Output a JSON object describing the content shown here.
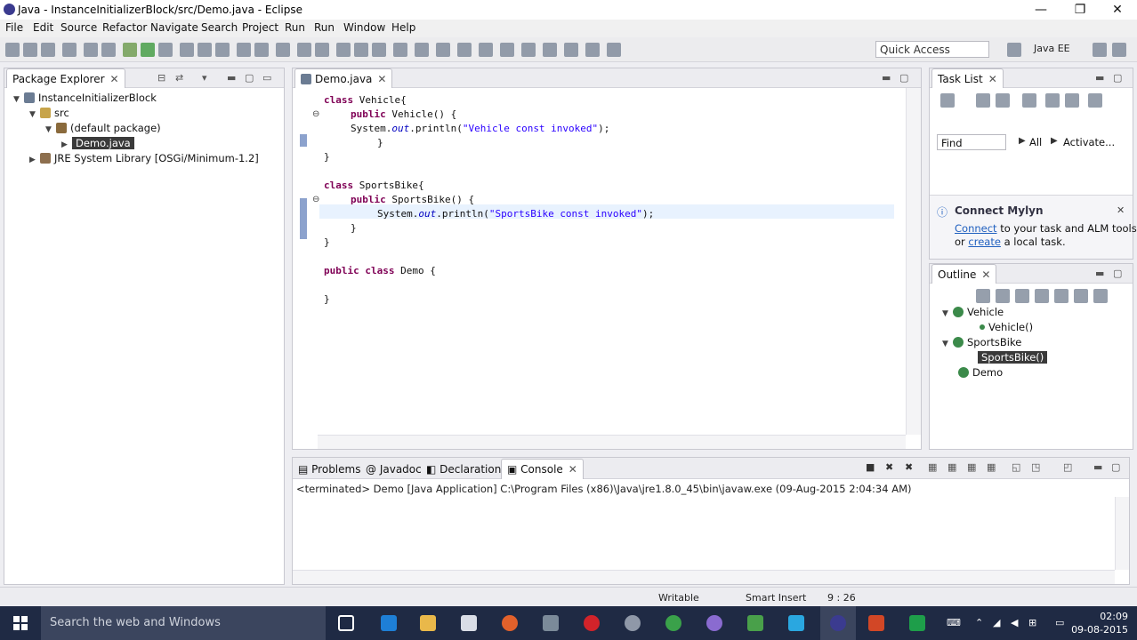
{
  "window": {
    "title": "Java - InstanceInitializerBlock/src/Demo.java - Eclipse"
  },
  "menu": [
    "File",
    "Edit",
    "Source",
    "Refactor",
    "Navigate",
    "Search",
    "Project",
    "Run",
    "Run",
    "Window",
    "Help"
  ],
  "toolbar": {
    "quick_access": "Quick Access",
    "perspective": "Java EE"
  },
  "package_explorer": {
    "tab": "Package Explorer",
    "tree": [
      {
        "label": "InstanceInitializerBlock",
        "level": 0,
        "expanded": true
      },
      {
        "label": "src",
        "level": 1,
        "expanded": true
      },
      {
        "label": "(default package)",
        "level": 2,
        "expanded": true
      },
      {
        "label": "Demo.java",
        "level": 3,
        "expanded": false,
        "selected": true
      },
      {
        "label": "JRE System Library [OSGi/Minimum-1.2]",
        "level": 1,
        "expanded": false
      }
    ]
  },
  "editor": {
    "tab": "Demo.java",
    "lines": [
      {
        "indent": 0,
        "tokens": [
          [
            "kw",
            "class"
          ],
          [
            "t",
            " Vehicle{"
          ]
        ]
      },
      {
        "indent": 1,
        "fold": "⊖",
        "tokens": [
          [
            "kw",
            "public"
          ],
          [
            "t",
            " Vehicle() {"
          ]
        ]
      },
      {
        "indent": 1,
        "tokens": [
          [
            "t",
            "System."
          ],
          [
            "fld",
            "out"
          ],
          [
            "t",
            ".println("
          ],
          [
            "str",
            "\"Vehicle const invoked\""
          ],
          [
            "t",
            ");"
          ]
        ]
      },
      {
        "indent": 2,
        "tokens": [
          [
            "t",
            "}"
          ]
        ]
      },
      {
        "indent": 0,
        "tokens": [
          [
            "t",
            "}"
          ]
        ]
      },
      {
        "indent": 0,
        "tokens": []
      },
      {
        "indent": 0,
        "tokens": [
          [
            "kw",
            "class"
          ],
          [
            "t",
            " SportsBike{"
          ]
        ]
      },
      {
        "indent": 1,
        "fold": "⊖",
        "tokens": [
          [
            "kw",
            "public"
          ],
          [
            "t",
            " SportsBike() {"
          ]
        ]
      },
      {
        "indent": 2,
        "tokens": [
          [
            "t",
            "System."
          ],
          [
            "fld",
            "out"
          ],
          [
            "t",
            ".println("
          ],
          [
            "str",
            "\"SportsBike const invoked\""
          ],
          [
            "t",
            ");"
          ]
        ]
      },
      {
        "indent": 1,
        "tokens": [
          [
            "t",
            "}"
          ]
        ]
      },
      {
        "indent": 0,
        "tokens": [
          [
            "t",
            "}"
          ]
        ]
      },
      {
        "indent": 0,
        "tokens": []
      },
      {
        "indent": 0,
        "tokens": [
          [
            "kw",
            "public class"
          ],
          [
            "t",
            " Demo {"
          ]
        ]
      },
      {
        "indent": 0,
        "tokens": []
      },
      {
        "indent": 0,
        "tokens": [
          [
            "t",
            "}"
          ]
        ]
      }
    ]
  },
  "task_list": {
    "tab": "Task List",
    "find": "Find",
    "all": "All",
    "activate": "Activate..."
  },
  "mylyn": {
    "title": "Connect Mylyn",
    "line1_link": "Connect",
    "line1_rest": " to your task and ALM tools",
    "line2_pre": "or ",
    "line2_link": "create",
    "line2_rest": " a local task."
  },
  "outline": {
    "tab": "Outline",
    "items": [
      {
        "label": "Vehicle",
        "level": 0,
        "kind": "class"
      },
      {
        "label": "Vehicle()",
        "level": 1,
        "kind": "ctor"
      },
      {
        "label": "SportsBike",
        "level": 0,
        "kind": "class"
      },
      {
        "label": "SportsBike()",
        "level": 1,
        "kind": "ctor",
        "selected": true
      },
      {
        "label": "Demo",
        "level": 0,
        "kind": "class"
      }
    ]
  },
  "bottom": {
    "tabs": [
      "Problems",
      "Javadoc",
      "Declaration",
      "Console"
    ],
    "console_line": "<terminated> Demo [Java Application] C:\\Program Files (x86)\\Java\\jre1.8.0_45\\bin\\javaw.exe (09-Aug-2015 2:04:34 AM)"
  },
  "status": {
    "writable": "Writable",
    "insert": "Smart Insert",
    "position": "9 : 26"
  },
  "taskbar": {
    "search": "Search the web and Windows",
    "time": "02:09",
    "date": "09-08-2015"
  },
  "colors": {
    "keyword": "#7f0055",
    "string": "#2a00ff",
    "field": "#0000c0",
    "taskbar": "#1f2a44"
  }
}
